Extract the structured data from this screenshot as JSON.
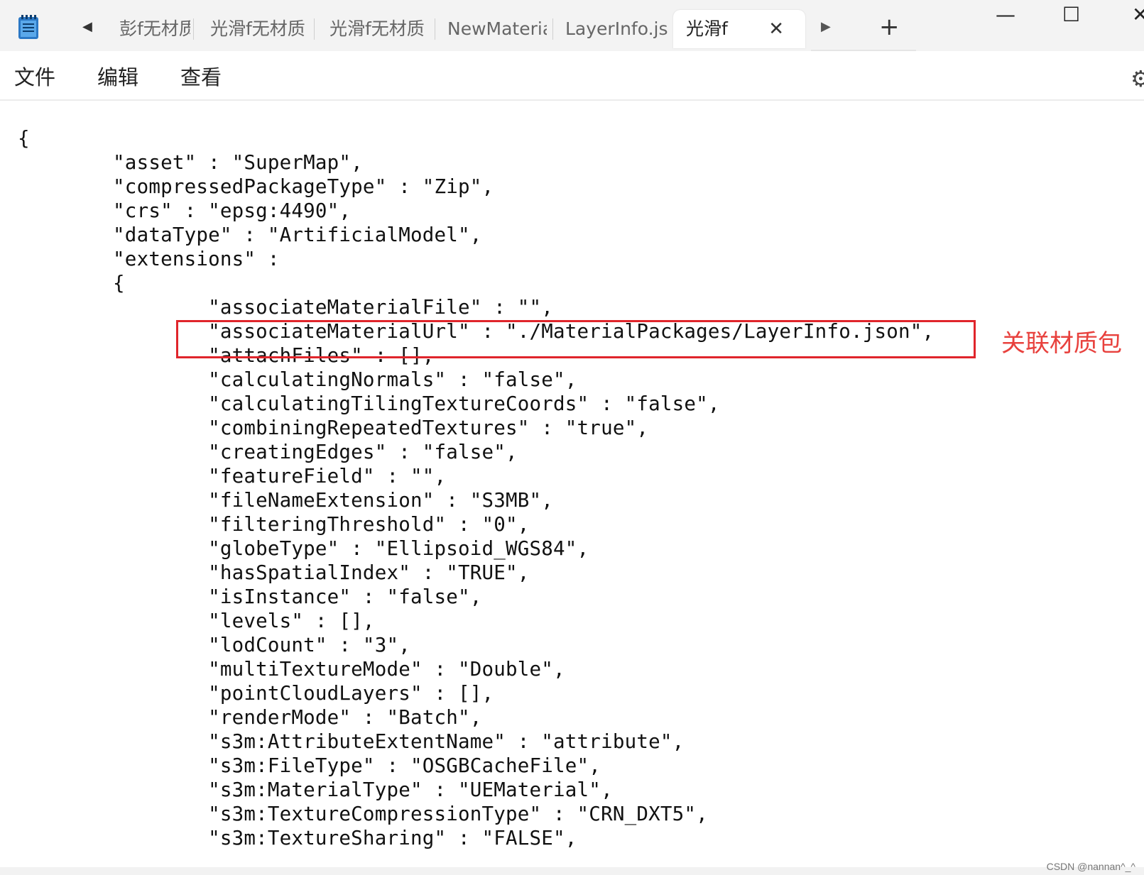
{
  "window": {
    "tabs": [
      {
        "label": "彭f无材质",
        "active": false
      },
      {
        "label": "光滑f无材质",
        "active": false
      },
      {
        "label": "光滑f无材质",
        "active": false
      },
      {
        "label": "NewMateria",
        "active": false
      },
      {
        "label": "LayerInfo.json",
        "active": false
      },
      {
        "label": "光滑f",
        "active": true
      }
    ],
    "icons": {
      "app": "notepad-icon",
      "scroll_left": "caret-left-icon",
      "scroll_right": "caret-right-icon",
      "close_tab": "close-icon",
      "new_tab": "plus-icon",
      "minimize": "minimize-icon",
      "maximize": "maximize-icon",
      "close_window": "close-window-icon",
      "settings": "gear-icon"
    },
    "glyphs": {
      "scroll_left": "◀",
      "scroll_right": "▶",
      "close_tab": "✕",
      "new_tab": "+",
      "minimize": "—",
      "maximize": "☐",
      "close_window": "✕",
      "settings": "⚙"
    }
  },
  "menu": {
    "file": "文件",
    "edit": "编辑",
    "view": "查看"
  },
  "editor": {
    "lines": [
      "{",
      "        \"asset\" : \"SuperMap\",",
      "        \"compressedPackageType\" : \"Zip\",",
      "        \"crs\" : \"epsg:4490\",",
      "        \"dataType\" : \"ArtificialModel\",",
      "        \"extensions\" :",
      "        {",
      "                \"associateMaterialFile\" : \"\",",
      "                \"associateMaterialUrl\" : \"./MaterialPackages/LayerInfo.json\",",
      "                \"attachFiles\" : [],",
      "                \"calculatingNormals\" : \"false\",",
      "                \"calculatingTilingTextureCoords\" : \"false\",",
      "                \"combiningRepeatedTextures\" : \"true\",",
      "                \"creatingEdges\" : \"false\",",
      "                \"featureField\" : \"\",",
      "                \"fileNameExtension\" : \"S3MB\",",
      "                \"filteringThreshold\" : \"0\",",
      "                \"globeType\" : \"Ellipsoid_WGS84\",",
      "                \"hasSpatialIndex\" : \"TRUE\",",
      "                \"isInstance\" : \"false\",",
      "                \"levels\" : [],",
      "                \"lodCount\" : \"3\",",
      "                \"multiTextureMode\" : \"Double\",",
      "                \"pointCloudLayers\" : [],",
      "                \"renderMode\" : \"Batch\",",
      "                \"s3m:AttributeExtentName\" : \"attribute\",",
      "                \"s3m:FileType\" : \"OSGBCacheFile\",",
      "                \"s3m:MaterialType\" : \"UEMaterial\",",
      "                \"s3m:TextureCompressionType\" : \"CRN_DXT5\",",
      "                \"s3m:TextureSharing\" : \"FALSE\","
    ],
    "annotation": "关联材质包",
    "annotation_color": "#e8413d",
    "highlight_color": "#e0252b"
  },
  "watermark": "CSDN @nannan^_^"
}
